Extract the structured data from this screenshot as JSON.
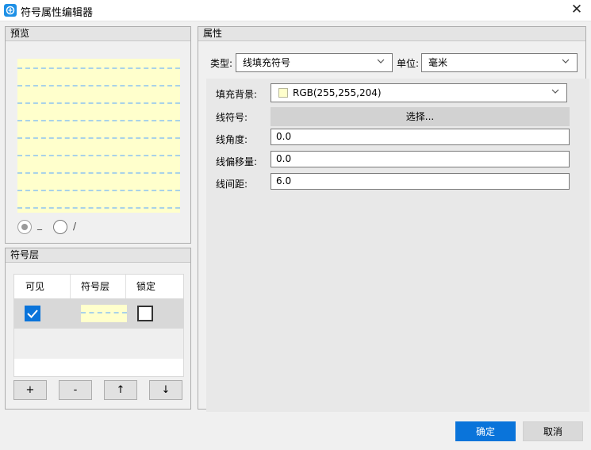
{
  "window": {
    "title": "符号属性编辑器",
    "close_glyph": "✕",
    "icon": "app-logo-icon"
  },
  "preview": {
    "header": "预览",
    "background_color": "#ffffcc",
    "line_color": "#a9d2e8",
    "radio_options": [
      {
        "label": "_",
        "checked": true
      },
      {
        "label": "/",
        "checked": false
      }
    ]
  },
  "layers": {
    "header": "符号层",
    "columns": [
      "可见",
      "符号层",
      "锁定"
    ],
    "rows": [
      {
        "visible": true,
        "locked": false
      }
    ],
    "buttons": {
      "add": "+",
      "remove": "-",
      "up": "↑",
      "down": "↓"
    }
  },
  "properties": {
    "header": "属性",
    "type_label": "类型:",
    "type_value": "线填充符号",
    "unit_label": "单位:",
    "unit_value": "毫米",
    "fill_bg_label": "填充背景:",
    "fill_bg_value": "RGB(255,255,204)",
    "fill_bg_color": "#ffffcc",
    "line_symbol_label": "线符号:",
    "line_symbol_button": "选择...",
    "line_angle_label": "线角度:",
    "line_angle_value": "0.0",
    "line_offset_label": "线偏移量:",
    "line_offset_value": "0.0",
    "line_spacing_label": "线间距:",
    "line_spacing_value": "6.0"
  },
  "footer": {
    "ok": "确定",
    "cancel": "取消",
    "accent_color": "#0a74da"
  }
}
